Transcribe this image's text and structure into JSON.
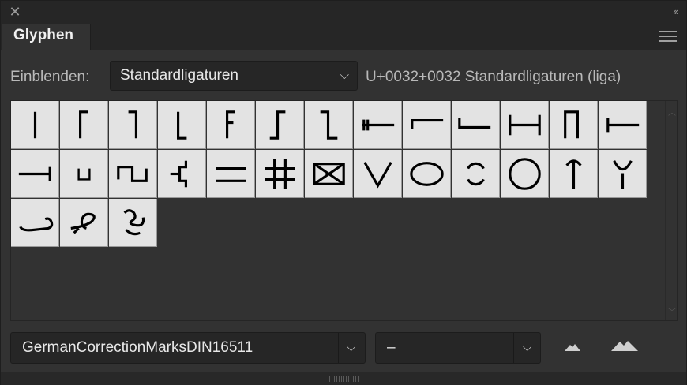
{
  "panel": {
    "title": "Glyphen",
    "close_icon": "close-x-icon",
    "collapse_icon": "double-chevron-left-icon",
    "menu_icon": "hamburger-menu-icon"
  },
  "filter": {
    "label": "Einblenden:",
    "selected": "Standardligaturen",
    "info": "U+0032+0032 Standardligaturen (liga)"
  },
  "glyphs": [
    "vertical-bar",
    "corner-top-left",
    "corner-top-right",
    "corner-bottom-left",
    "flag",
    "step-up",
    "step-down",
    "insert-mark-left",
    "half-bracket-top",
    "half-bracket-bottom",
    "span-bracket",
    "tall-u-bracket",
    "t-left",
    "t-right",
    "small-u",
    "wave-bracket",
    "zigzag-bracket",
    "double-line",
    "hash",
    "boxed-x",
    "v-mark",
    "ellipse",
    "open-circle",
    "circle",
    "up-arrow",
    "y-fork",
    "loop-tilde",
    "loop-swash",
    "delete-sign"
  ],
  "footer": {
    "font_name": "GermanCorrectionMarksDIN16511",
    "font_style": "–",
    "zoom_out_icon": "small-mountain-icon",
    "zoom_in_icon": "large-mountain-icon"
  },
  "colors": {
    "panel_bg": "#323232",
    "cell_bg": "#e3e3e3",
    "glyph": "#000000"
  }
}
